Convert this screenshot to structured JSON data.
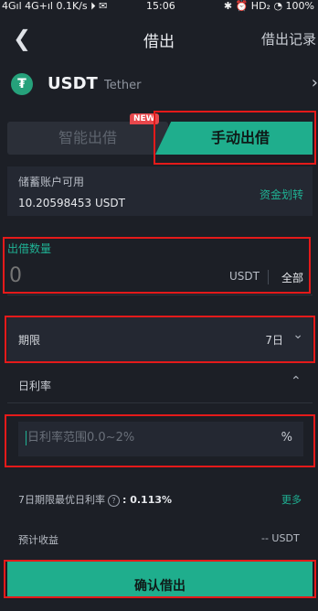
{
  "status_bar": {
    "left": "4Gıl 4G+ıl 0.1K/s ⏵ ✉",
    "time": "15:06",
    "right": "✱ ⏰ HD₂ ◔ 100%"
  },
  "nav": {
    "title": "借出",
    "right_link": "借出记录"
  },
  "coin": {
    "symbol": "USDT",
    "name": "Tether"
  },
  "tabs": {
    "auto_label": "智能出借",
    "manual_label": "手动出借",
    "new_badge": "NEW",
    "active": "manual"
  },
  "balance": {
    "label": "储蓄账户可用",
    "value": "10.20598453 USDT",
    "transfer_label": "资金划转"
  },
  "amount": {
    "label": "出借数量",
    "placeholder": "0",
    "unit": "USDT",
    "all_label": "全部"
  },
  "period": {
    "label": "期限",
    "value": "7日"
  },
  "rate": {
    "label": "日利率",
    "placeholder": "日利率范围0.0~2%",
    "unit": "%"
  },
  "best_rate": {
    "label": "7日期限最优日利率",
    "question_icon": "?",
    "value": ": 0.113%",
    "more_label": "更多"
  },
  "expected": {
    "label": "预计收益",
    "value": "-- USDT"
  },
  "confirm_label": "确认借出",
  "colors": {
    "accent": "#1fae8d",
    "highlight": "#e41a1a",
    "background": "#1c1f26"
  }
}
